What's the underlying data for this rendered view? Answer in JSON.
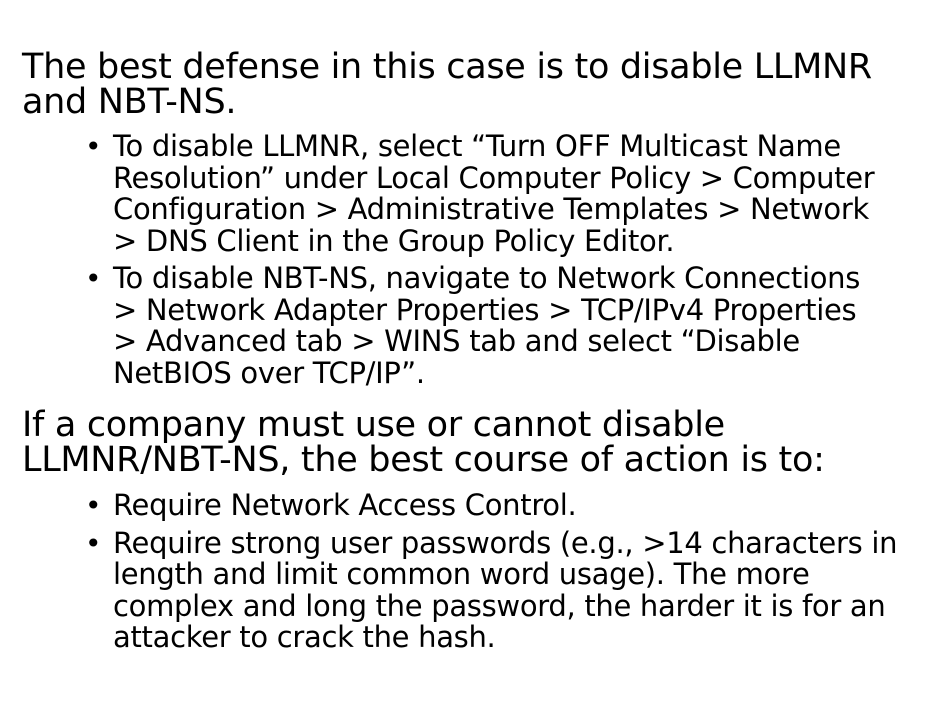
{
  "section1": {
    "heading_lines": [
      "The best defense in this case is to disable LLMNR",
      "and NBT-NS."
    ],
    "bullets": [
      {
        "lines": [
          "To disable LLMNR, select “Turn OFF Multicast Name",
          "Resolution” under Local Computer Policy > Computer",
          "Configuration > Administrative Templates > Network",
          "> DNS Client in the Group Policy Editor."
        ]
      },
      {
        "lines": [
          "To disable NBT-NS, navigate to Network Connections",
          "> Network Adapter Properties > TCP/IPv4 Properties",
          "> Advanced tab > WINS tab and select “Disable",
          "NetBIOS over TCP/IP”."
        ]
      }
    ]
  },
  "section2": {
    "heading_lines": [
      "If a company must use or cannot disable",
      "LLMNR/NBT-NS, the best course of action is to:"
    ],
    "bullets": [
      {
        "lines": [
          "Require Network Access Control."
        ]
      },
      {
        "lines": [
          "Require strong user passwords (e.g., >14 characters in",
          "length and limit common word usage).  The more",
          "complex and long the password, the harder it is for an",
          "attacker to crack the hash."
        ]
      }
    ]
  },
  "bullet_symbol": "•"
}
